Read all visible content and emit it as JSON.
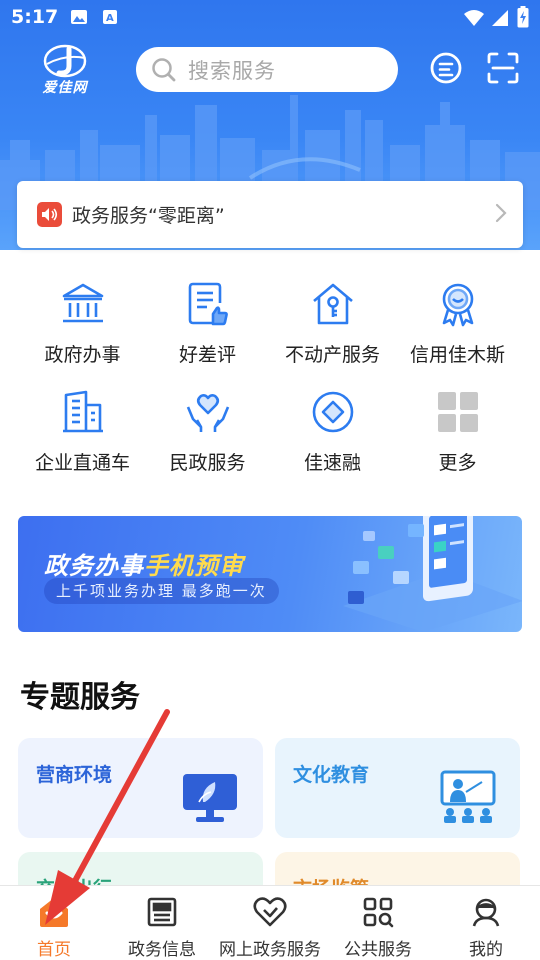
{
  "colors": {
    "primary_blue": "#3a86f5",
    "accent_orange": "#f5792a",
    "notice_red": "#ea4c3a",
    "annotation_red": "#e53b36"
  },
  "status_bar": {
    "time": "5:17",
    "left_icons": [
      "image-icon",
      "text-notification-icon"
    ],
    "right_icons": [
      "wifi-icon",
      "signal-icon",
      "battery-charging-icon"
    ]
  },
  "header": {
    "logo_text": "爱佳网",
    "search": {
      "placeholder": "搜索服务",
      "icon": "search-icon"
    },
    "actions": [
      {
        "name": "message-icon"
      },
      {
        "name": "scan-icon"
      }
    ]
  },
  "notice": {
    "text": "政务服务“零距离”",
    "icon": "speaker-icon"
  },
  "services": [
    {
      "label": "政府办事",
      "icon": "government-building-icon"
    },
    {
      "label": "好差评",
      "icon": "evaluation-thumb-icon"
    },
    {
      "label": "不动产服务",
      "icon": "house-key-icon"
    },
    {
      "label": "信用佳木斯",
      "icon": "credit-badge-icon"
    },
    {
      "label": "企业直通车",
      "icon": "office-building-icon"
    },
    {
      "label": "民政服务",
      "icon": "heart-hands-icon"
    },
    {
      "label": "佳速融",
      "icon": "diamond-circle-icon"
    },
    {
      "label": "更多",
      "icon": "more-grid-icon"
    }
  ],
  "banner": {
    "title_part1": "政务办事",
    "title_part2": "手机预审",
    "subtitle": "上千项业务办理 最多跑一次"
  },
  "topics": {
    "title": "专题服务",
    "items": [
      {
        "label": "营商环境",
        "color": "#2c64d8",
        "bg": "#eef3fe"
      },
      {
        "label": "文化教育",
        "color": "#2f8fe0",
        "bg": "#e8f4fd"
      },
      {
        "label": "交通出行",
        "color": "#2aa37a",
        "bg": "#e9f7f1"
      },
      {
        "label": "市场监管",
        "color": "#e08a2a",
        "bg": "#fdf5e6"
      }
    ]
  },
  "tabbar": {
    "items": [
      {
        "label": "首页",
        "icon": "home-icon",
        "active": true
      },
      {
        "label": "政务信息",
        "icon": "news-icon",
        "active": false
      },
      {
        "label": "网上政务服务",
        "icon": "heart-service-icon",
        "active": false
      },
      {
        "label": "公共服务",
        "icon": "apps-search-icon",
        "active": false
      },
      {
        "label": "我的",
        "icon": "profile-icon",
        "active": false
      }
    ]
  }
}
